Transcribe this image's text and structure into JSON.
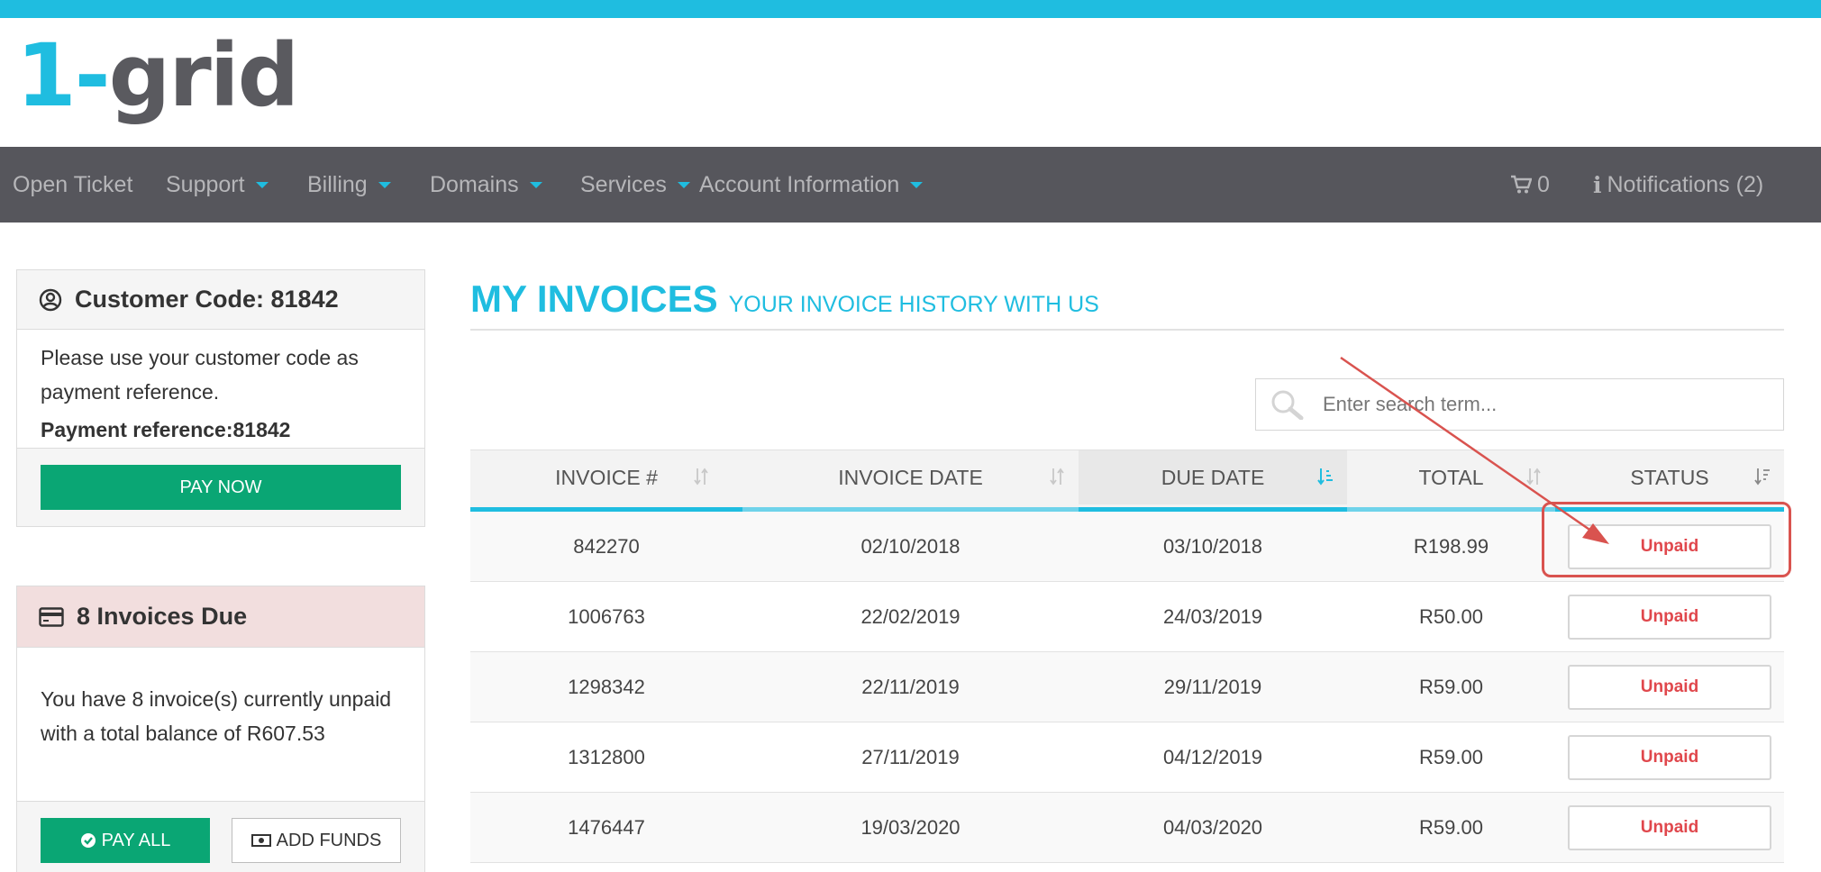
{
  "logo": {
    "part1": "1-",
    "part2": "grid"
  },
  "nav": {
    "items": [
      {
        "label": "Open Ticket",
        "caret": false
      },
      {
        "label": "Support",
        "caret": true
      },
      {
        "label": "Billing",
        "caret": true
      },
      {
        "label": "Domains",
        "caret": true
      },
      {
        "label": "Services",
        "caret": true
      },
      {
        "label": "Account Information",
        "caret": true
      }
    ],
    "cart_count": "0",
    "notifications": "Notifications (2)"
  },
  "customer_panel": {
    "title": "Customer Code: 81842",
    "text": "Please use your customer code as payment reference.",
    "reference": "Payment reference:81842",
    "pay_now": "PAY NOW"
  },
  "invoices_panel": {
    "title": "8 Invoices Due",
    "text": "You have 8 invoice(s) currently unpaid with a total balance of R607.53",
    "pay_all": "PAY ALL",
    "add_funds": "ADD FUNDS"
  },
  "page": {
    "title": "MY INVOICES",
    "subtitle": "YOUR INVOICE HISTORY WITH US"
  },
  "search": {
    "placeholder": "Enter search term..."
  },
  "table": {
    "headers": [
      "INVOICE #",
      "INVOICE DATE",
      "DUE DATE",
      "TOTAL",
      "STATUS"
    ],
    "rows": [
      {
        "invoice": "842270",
        "date": "02/10/2018",
        "due": "03/10/2018",
        "total": "R198.99",
        "status": "Unpaid"
      },
      {
        "invoice": "1006763",
        "date": "22/02/2019",
        "due": "24/03/2019",
        "total": "R50.00",
        "status": "Unpaid"
      },
      {
        "invoice": "1298342",
        "date": "22/11/2019",
        "due": "29/11/2019",
        "total": "R59.00",
        "status": "Unpaid"
      },
      {
        "invoice": "1312800",
        "date": "27/11/2019",
        "due": "04/12/2019",
        "total": "R59.00",
        "status": "Unpaid"
      },
      {
        "invoice": "1476447",
        "date": "19/03/2020",
        "due": "04/03/2020",
        "total": "R59.00",
        "status": "Unpaid"
      }
    ]
  },
  "colors": {
    "accent": "#1fbde0",
    "nav_bg": "#56565c",
    "green": "#0aa674",
    "unpaid": "#e0474c",
    "annotation": "#d9534f"
  },
  "icons": [
    "user-circle-icon",
    "credit-card-icon",
    "cart-icon",
    "info-icon",
    "search-icon",
    "sort-icon",
    "check-circle-icon",
    "money-icon"
  ]
}
